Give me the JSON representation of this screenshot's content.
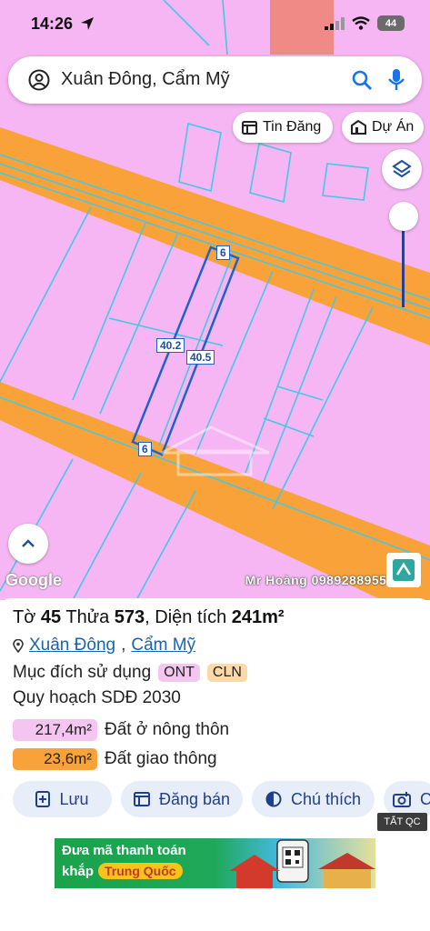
{
  "status": {
    "time": "14:26",
    "battery": "44"
  },
  "search": {
    "text": "Xuân Đông, Cẩm Mỹ"
  },
  "chips": {
    "tin_dang": "Tin Đăng",
    "du_an": "Dự Án"
  },
  "map": {
    "dims": {
      "top": "6",
      "left": "40.2",
      "right": "40.5",
      "bottom": "6"
    },
    "attribution": "Google",
    "watermark": "Mr Hoàng 0989288955 2030"
  },
  "parcel": {
    "to_label": "Tờ",
    "to": "45",
    "thua_label": "Thửa",
    "thua": "573",
    "area_label": "Diện tích",
    "area": "241m²",
    "commune": "Xuân Đông",
    "district": "Cẩm Mỹ",
    "purpose_label": "Mục đích sử dụng",
    "purpose_tags": [
      "ONT",
      "CLN"
    ],
    "plan_label": "Quy hoạch SDĐ 2030",
    "zones": [
      {
        "area": "217,4m²",
        "name": "Đất ở nông thôn"
      },
      {
        "area": "23,6m²",
        "name": "Đất giao thông"
      }
    ]
  },
  "actions": {
    "luu": "Lưu",
    "dang_ban": "Đăng bán",
    "chu_thich": "Chú thích",
    "more": "C"
  },
  "ad": {
    "close": "TẮT QC",
    "line1": "Đưa mã thanh toán",
    "line2": "khắp",
    "pill": "Trung Quốc"
  },
  "colors": {
    "land": "#f6b6f3",
    "road": "#f9a23a",
    "boundary": "#45c8e0",
    "accent": "#1e4fa0"
  }
}
